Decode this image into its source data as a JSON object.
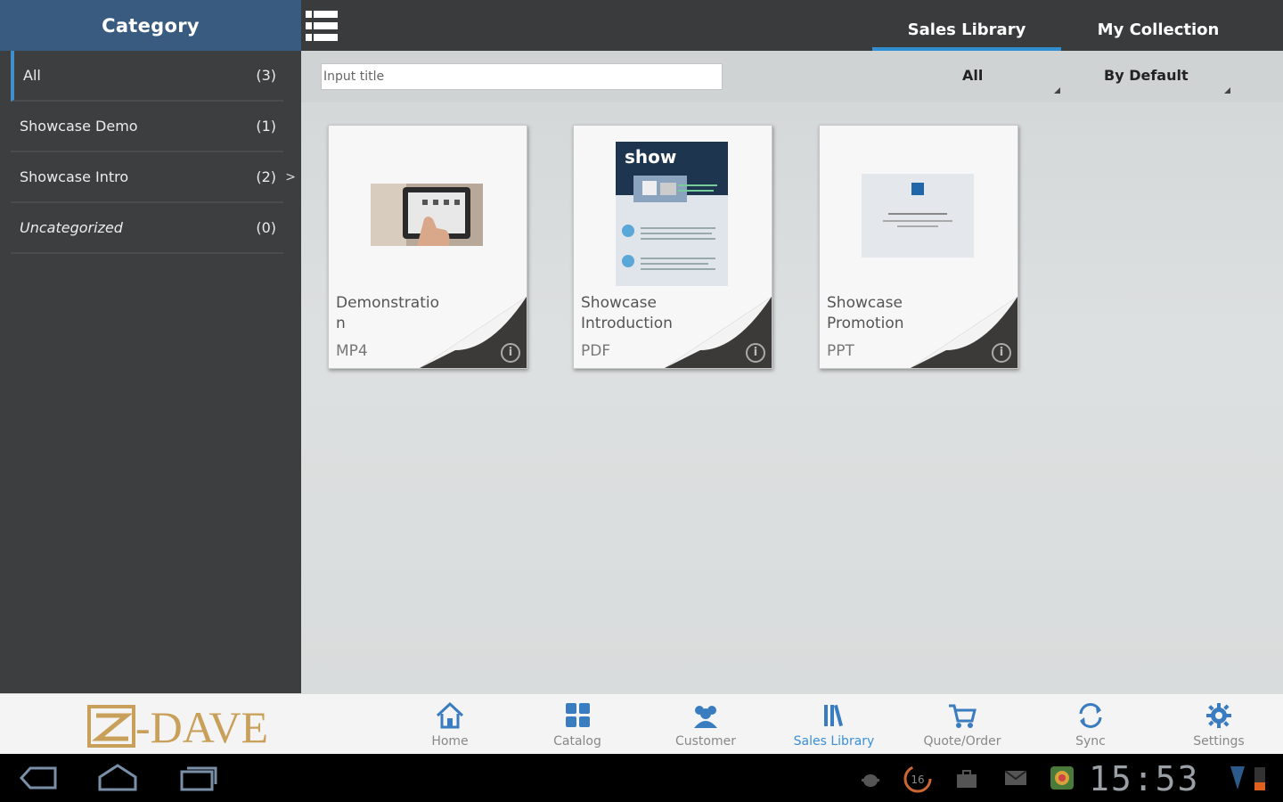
{
  "sidebar": {
    "title": "Category",
    "items": [
      {
        "label": "All",
        "count": "(3)"
      },
      {
        "label": "Showcase Demo",
        "count": "(1)"
      },
      {
        "label": "Showcase Intro",
        "count": "(2)",
        "arrow": ">"
      },
      {
        "label": "Uncategorized",
        "count": "(0)"
      }
    ]
  },
  "topbar": {
    "tabs": [
      {
        "label": "Sales Library"
      },
      {
        "label": "My Collection"
      }
    ]
  },
  "filters": {
    "search_placeholder": "Input title",
    "type_filter": "All",
    "sort_filter": "By Default"
  },
  "cards": [
    {
      "title": "Demonstratio\nn",
      "type": "MP4"
    },
    {
      "title": "Showcase\nIntroduction",
      "type": "PDF",
      "thumb_text": "show"
    },
    {
      "title": "Showcase\nPromotion",
      "type": "PPT"
    }
  ],
  "brand": {
    "logo_text": "-DAVE",
    "color": "#c9a05a"
  },
  "bottom_nav": [
    {
      "label": "Home",
      "icon": "home-icon"
    },
    {
      "label": "Catalog",
      "icon": "catalog-icon"
    },
    {
      "label": "Customer",
      "icon": "customer-icon"
    },
    {
      "label": "Sales Library",
      "icon": "sales-library-icon"
    },
    {
      "label": "Quote/Order",
      "icon": "cart-icon"
    },
    {
      "label": "Sync",
      "icon": "sync-icon"
    },
    {
      "label": "Settings",
      "icon": "gear-icon"
    }
  ],
  "system_bar": {
    "clock": "15:53",
    "notification_count": "16"
  },
  "colors": {
    "accent": "#2f8fd0",
    "sidebar_header": "#3a5b80",
    "active_nav": "#3a8fd8"
  }
}
